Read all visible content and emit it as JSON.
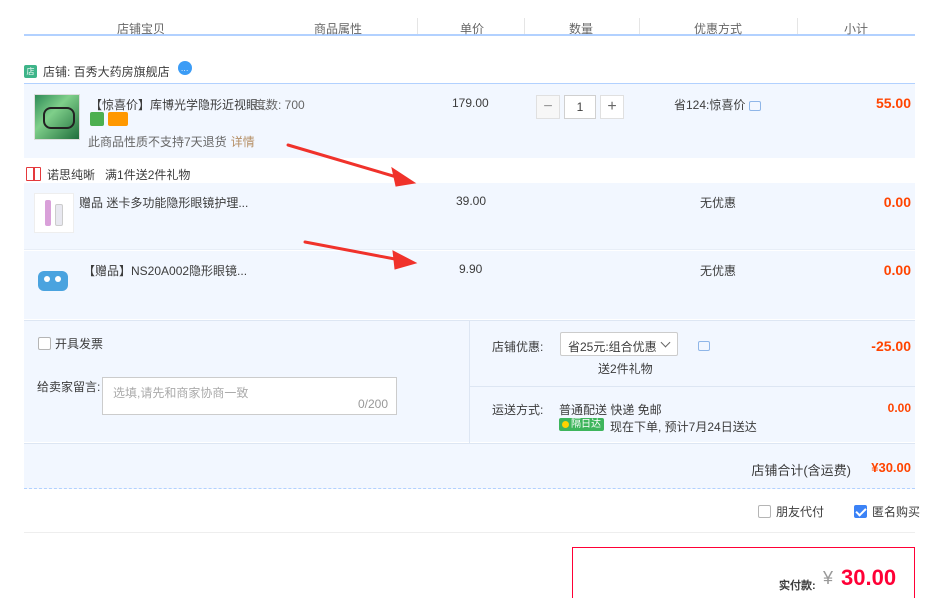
{
  "header": {
    "columns": [
      "店铺宝贝",
      "商品属性",
      "单价",
      "数量",
      "优惠方式",
      "小计"
    ]
  },
  "store": {
    "name": "店铺: 百秀大药房旗舰店",
    "icon": "store-icon",
    "ww_icon": "chat-bubble-icon"
  },
  "main_item": {
    "title": "【惊喜价】库博光学隐形近视眼...",
    "attribute": "度数: 700",
    "no_return_note": "此商品性质不支持7天退货",
    "detail_link": "详情",
    "price": "179.00",
    "quantity": "1",
    "discount": "省124:惊喜价",
    "subtotal": "55.00"
  },
  "promo": {
    "name": "诺思纯晰",
    "rule": "满1件送2件礼物"
  },
  "gifts": [
    {
      "title": "赠品 迷卡多功能隐形眼镜护理...",
      "price": "39.00",
      "discount": "无优惠",
      "subtotal": "0.00"
    },
    {
      "title": "【赠品】NS20A002隐形眼镜...",
      "price": "9.90",
      "discount": "无优惠",
      "subtotal": "0.00"
    }
  ],
  "options": {
    "invoice_label": "开具发票",
    "message_label": "给卖家留言:",
    "message_placeholder": "选填,请先和商家协商一致",
    "message_count": "0/200",
    "shop_discount_label": "店铺优惠:",
    "shop_discount_selected": "省25元:组合优惠",
    "gift_note": "送2件礼物",
    "shop_discount_value": "-25.00",
    "shipping_label": "运送方式:",
    "shipping_mode": "普通配送 快递 免邮",
    "shipping_tag": "隔日达",
    "shipping_note": "现在下单, 预计7月24日送达",
    "shipping_value": "0.00"
  },
  "total": {
    "label": "店铺合计(含运费)",
    "value": "¥30.00"
  },
  "checkout": {
    "friend_pay": "朋友代付",
    "anonymous": "匿名购买",
    "anonymous_checked": true,
    "pay_label": "实付款:",
    "currency": "¥",
    "amount": "30.00"
  },
  "colors": {
    "accent_red": "#ff0036",
    "price_red": "#f40",
    "panel_bg": "#f2f7ff",
    "border_blue": "#b2d1ff",
    "annotation_arrow": "#f0322b"
  }
}
